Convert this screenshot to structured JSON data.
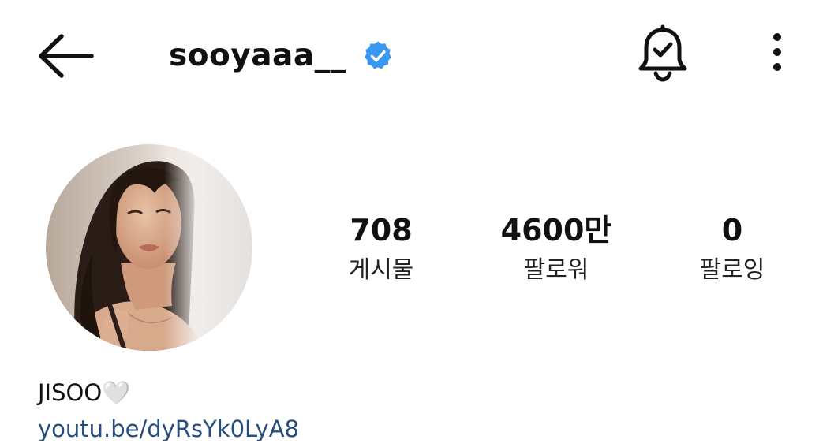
{
  "header": {
    "back_icon": "arrow-left-icon",
    "username": "sooyaaa__",
    "verified_icon": "verified-badge-icon",
    "notification_icon": "bell-check-icon",
    "more_icon": "more-vertical-icon",
    "verified_color": "#3897f0"
  },
  "profile": {
    "avatar_icon": "profile-photo",
    "stats": [
      {
        "value": "708",
        "label": "게시물"
      },
      {
        "value": "4600만",
        "label": "팔로워"
      },
      {
        "value": "0",
        "label": "팔로잉"
      }
    ]
  },
  "bio": {
    "name": "JISOO🤍",
    "link": "youtu.be/dyRsYk0LyA8",
    "link_color": "#274d7d"
  }
}
